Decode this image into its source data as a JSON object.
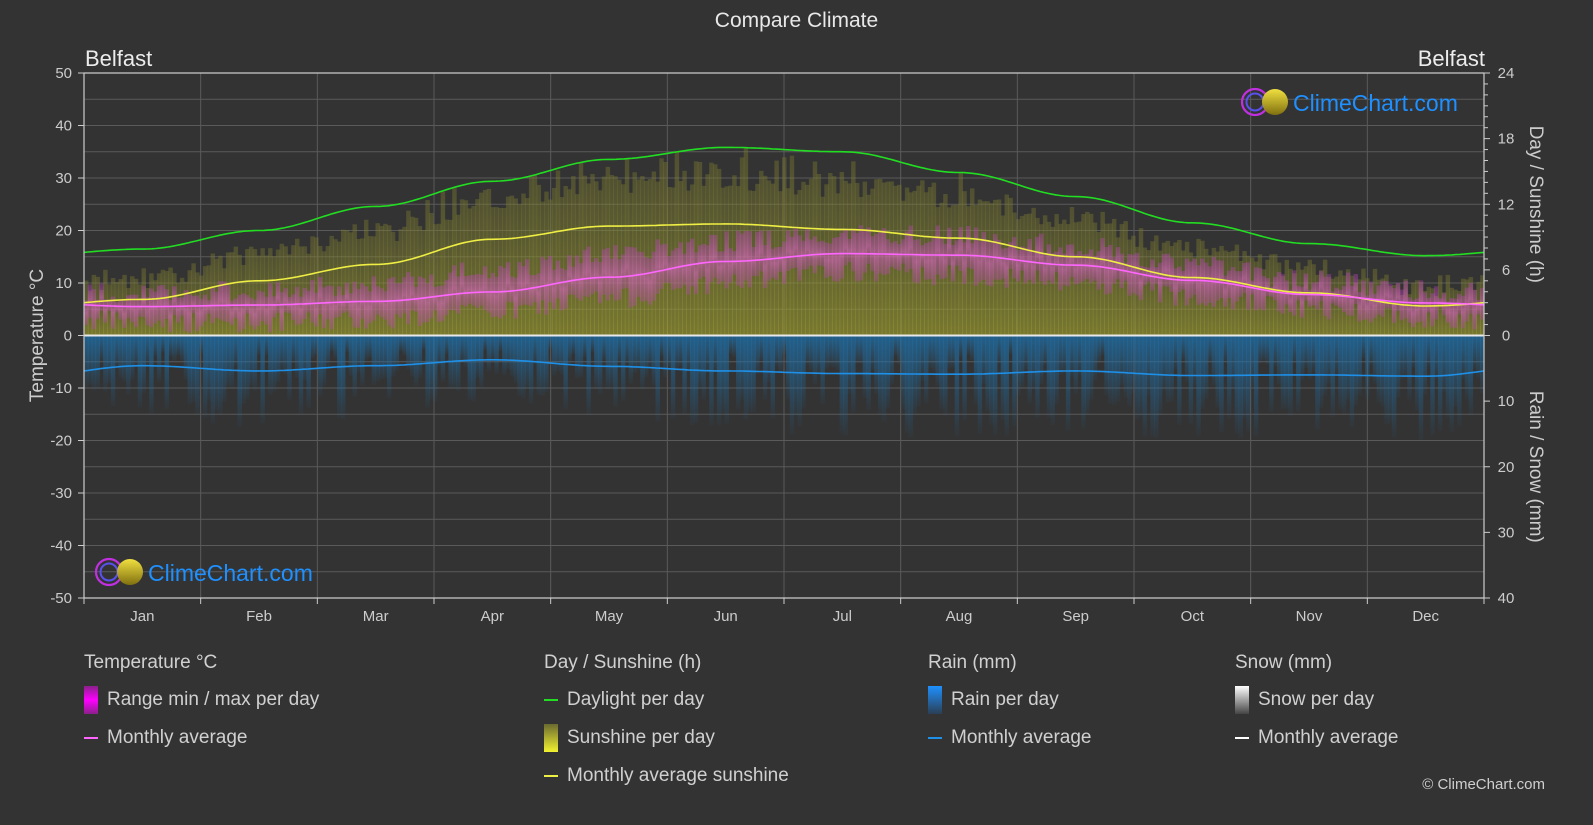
{
  "title": "Compare Climate",
  "city_left": "Belfast",
  "city_right": "Belfast",
  "watermark": "ClimeChart.com",
  "copyright": "© ClimeChart.com",
  "colors": {
    "background": "#333333",
    "temperature": "#ff66ff",
    "temperature_range": "#e040e0",
    "daylight": "#22dd22",
    "sunshine": "#eeee44",
    "sunshine_fill": "#a0a030",
    "rain": "#1e90e8",
    "snow": "#ffffff",
    "watermark": "#1e90ff"
  },
  "legend": {
    "temperature": {
      "heading": "Temperature °C",
      "items": [
        {
          "label": "Range min / max per day",
          "icon": "range-swatch"
        },
        {
          "label": "Monthly average",
          "icon": "line-swatch"
        }
      ]
    },
    "sunshine": {
      "heading": "Day / Sunshine (h)",
      "items": [
        {
          "label": "Daylight per day",
          "icon": "line-swatch"
        },
        {
          "label": "Sunshine per day",
          "icon": "bar-swatch"
        },
        {
          "label": "Monthly average sunshine",
          "icon": "line-swatch"
        }
      ]
    },
    "rain": {
      "heading": "Rain (mm)",
      "items": [
        {
          "label": "Rain per day",
          "icon": "bar-swatch"
        },
        {
          "label": "Monthly average",
          "icon": "line-swatch"
        }
      ]
    },
    "snow": {
      "heading": "Snow (mm)",
      "items": [
        {
          "label": "Snow per day",
          "icon": "bar-swatch"
        },
        {
          "label": "Monthly average",
          "icon": "line-swatch"
        }
      ]
    }
  },
  "chart_data": {
    "type": "line",
    "title": "Compare Climate",
    "categories": [
      "Jan",
      "Feb",
      "Mar",
      "Apr",
      "May",
      "Jun",
      "Jul",
      "Aug",
      "Sep",
      "Oct",
      "Nov",
      "Dec"
    ],
    "axes": {
      "left": {
        "label": "Temperature °C",
        "range": [
          -50,
          50
        ],
        "ticks": [
          50,
          40,
          30,
          20,
          10,
          0,
          -10,
          -20,
          -30,
          -40,
          -50
        ]
      },
      "right_top": {
        "label": "Day / Sunshine (h)",
        "range": [
          0,
          24
        ],
        "ticks": [
          24,
          18,
          12,
          6,
          0
        ]
      },
      "right_bottom": {
        "label": "Rain / Snow (mm)",
        "range": [
          0,
          40
        ],
        "ticks": [
          0,
          10,
          20,
          30,
          40
        ]
      }
    },
    "grid": true,
    "legend_position": "bottom",
    "series": [
      {
        "name": "Temperature monthly average (°C)",
        "axis": "left",
        "values": [
          5.5,
          5.8,
          6.5,
          8.3,
          11.1,
          14.1,
          15.6,
          15.3,
          13.4,
          10.5,
          7.8,
          6.2
        ]
      },
      {
        "name": "Temperature daily max range (°C)",
        "axis": "left",
        "values": [
          8,
          8.5,
          10,
          12.5,
          15.5,
          18,
          19.5,
          19,
          17,
          13.5,
          10.5,
          8.5
        ]
      },
      {
        "name": "Temperature daily min range (°C)",
        "axis": "left",
        "values": [
          2.5,
          2.5,
          3,
          4.5,
          7,
          10,
          12,
          11.5,
          10,
          7.5,
          5,
          3.5
        ]
      },
      {
        "name": "Daylight per day (h)",
        "axis": "right_top",
        "values": [
          7.9,
          9.6,
          11.8,
          14.1,
          16.1,
          17.2,
          16.8,
          14.9,
          12.7,
          10.3,
          8.4,
          7.3
        ]
      },
      {
        "name": "Monthly average sunshine (h)",
        "axis": "right_top",
        "values": [
          3.3,
          5.0,
          6.5,
          8.8,
          10.0,
          10.2,
          9.7,
          8.9,
          7.2,
          5.3,
          3.9,
          2.7
        ]
      },
      {
        "name": "Rain monthly average (mm)",
        "axis": "right_bottom",
        "values": [
          4.6,
          5.4,
          4.6,
          3.7,
          4.7,
          5.4,
          5.8,
          5.9,
          5.4,
          6.1,
          6.0,
          6.2
        ]
      },
      {
        "name": "Snow monthly average (mm)",
        "axis": "right_bottom",
        "values": [
          0.1,
          0.1,
          0.05,
          0,
          0,
          0,
          0,
          0,
          0,
          0,
          0,
          0.05
        ]
      }
    ]
  }
}
